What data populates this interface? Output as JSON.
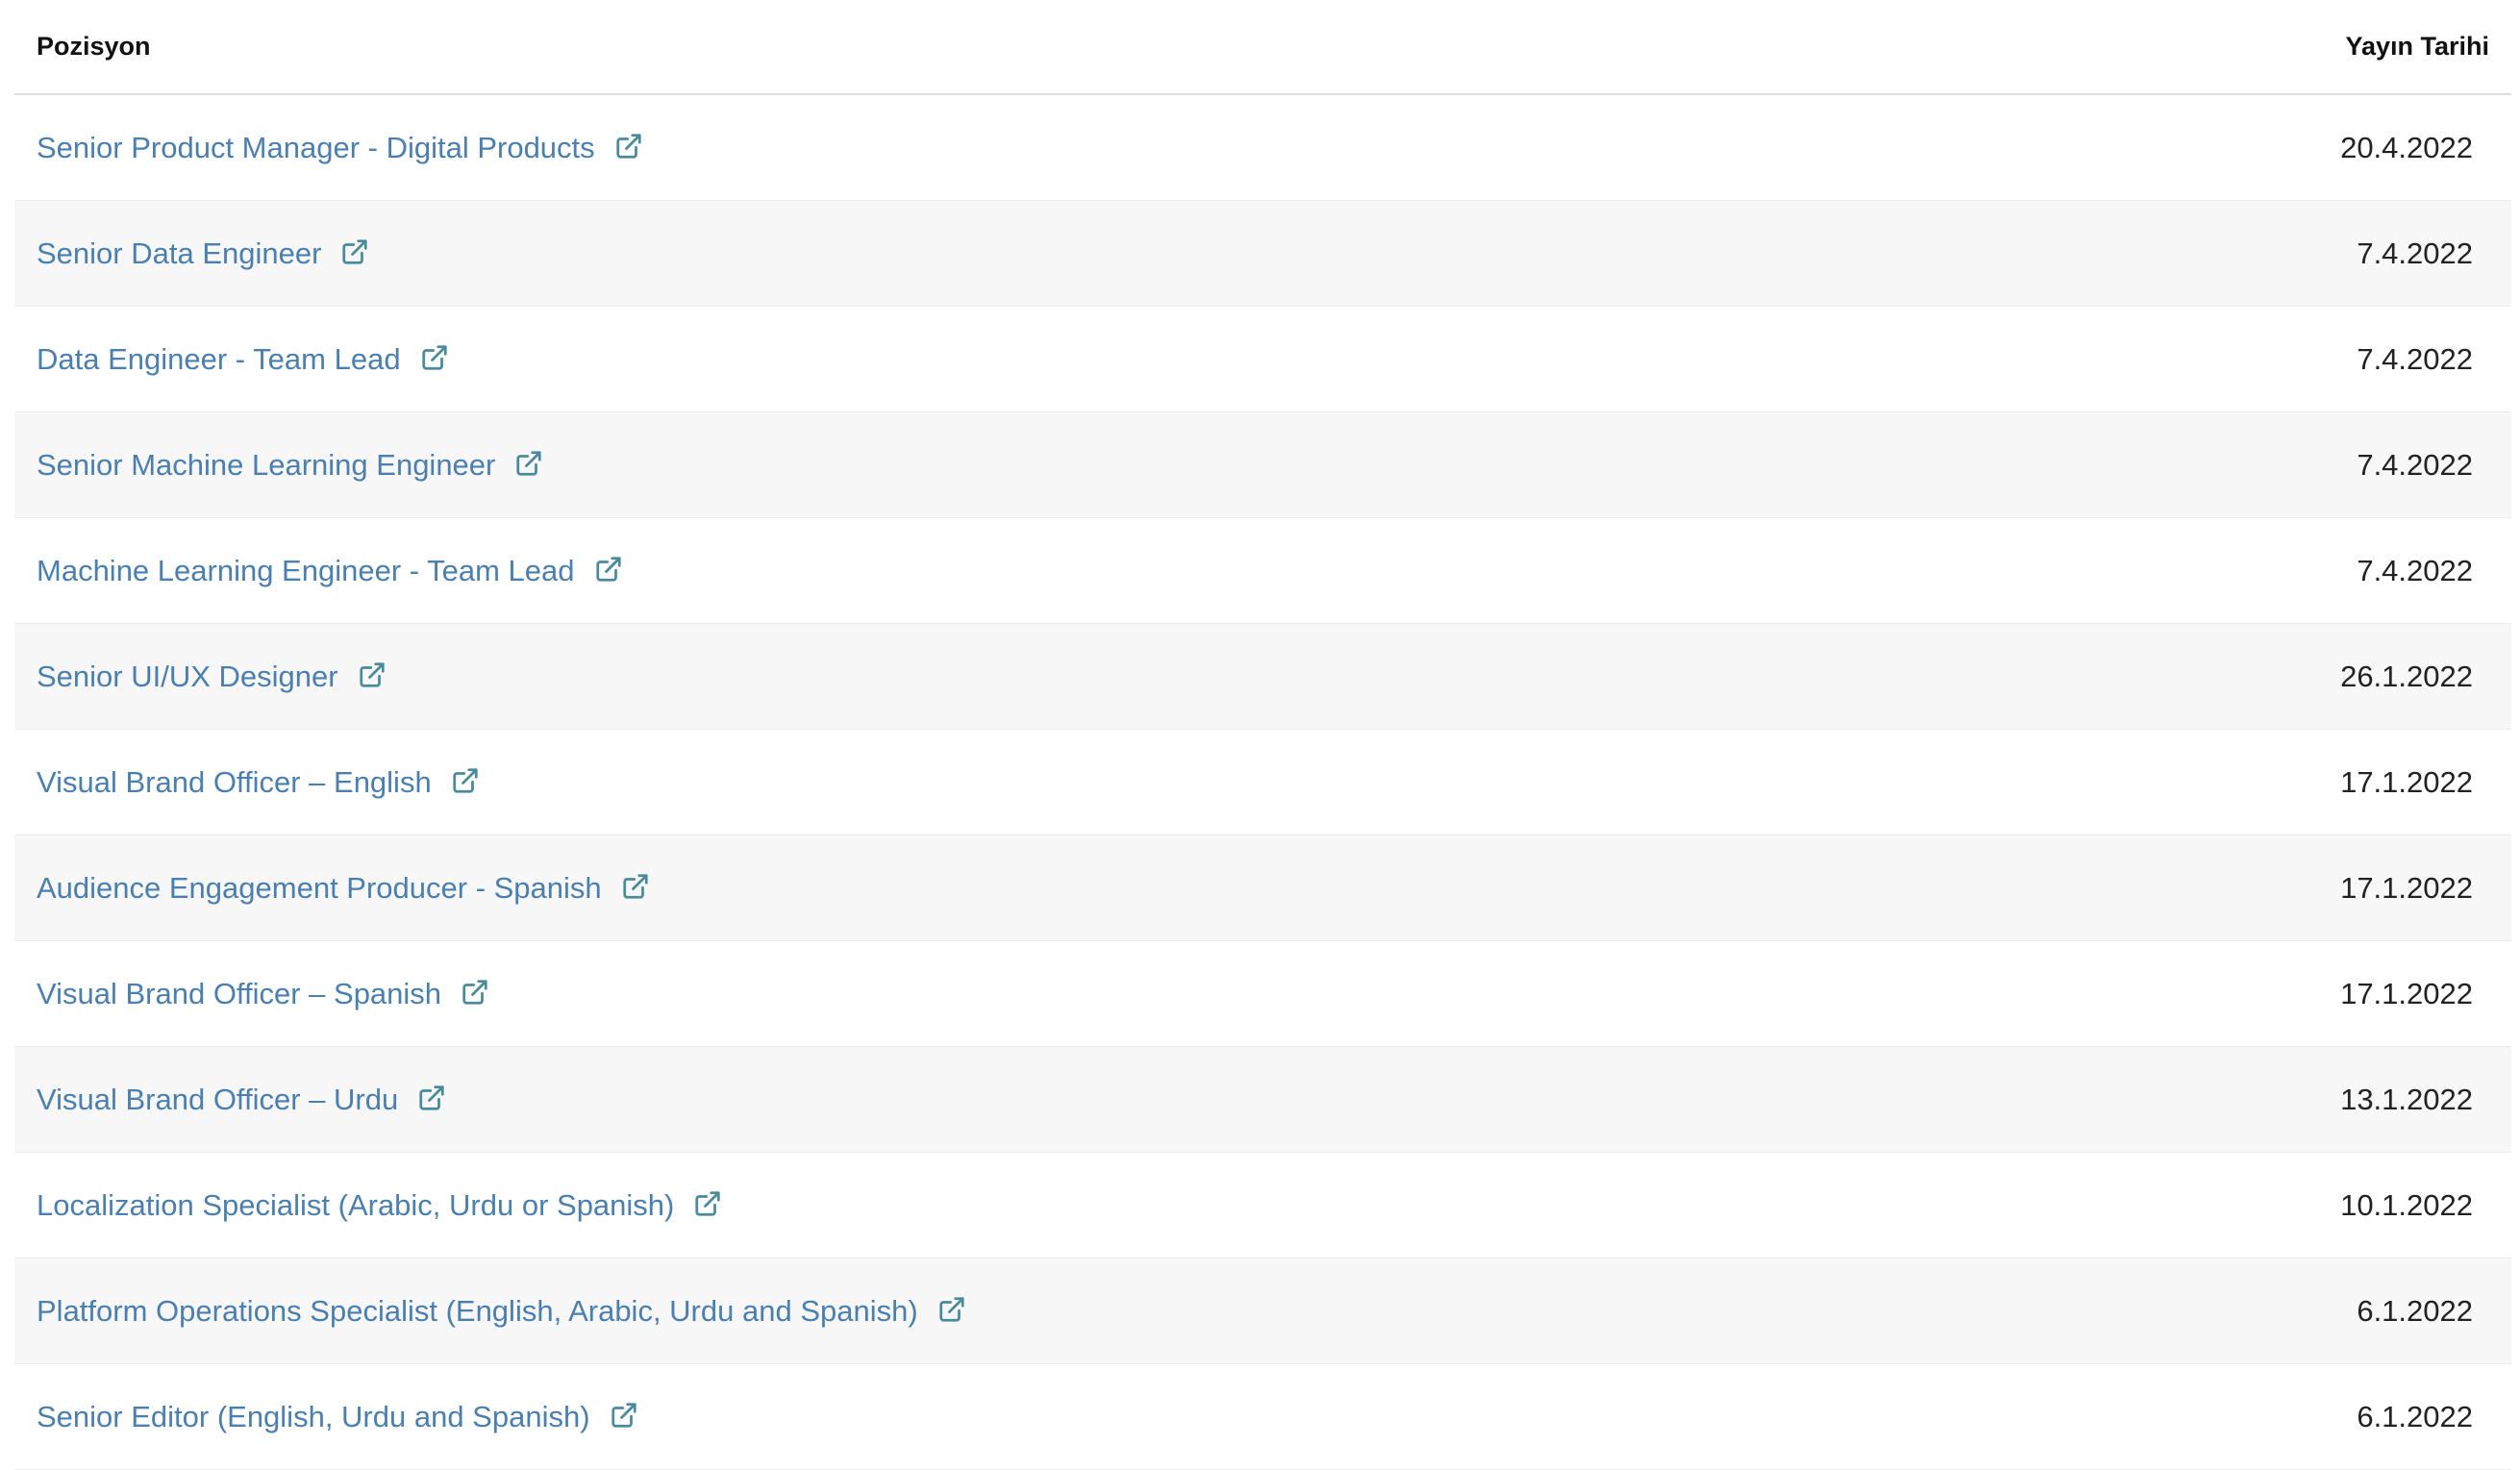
{
  "table": {
    "headers": {
      "position": "Pozisyon",
      "date": "Yayın Tarihi"
    },
    "rows": [
      {
        "title": "Senior Product Manager - Digital Products",
        "date": "20.4.2022"
      },
      {
        "title": "Senior Data Engineer",
        "date": "7.4.2022"
      },
      {
        "title": "Data Engineer - Team Lead",
        "date": "7.4.2022"
      },
      {
        "title": "Senior Machine Learning Engineer",
        "date": "7.4.2022"
      },
      {
        "title": "Machine Learning Engineer - Team Lead",
        "date": "7.4.2022"
      },
      {
        "title": "Senior UI/UX Designer",
        "date": "26.1.2022"
      },
      {
        "title": "Visual Brand Officer – English",
        "date": "17.1.2022"
      },
      {
        "title": "Audience Engagement Producer - Spanish",
        "date": "17.1.2022"
      },
      {
        "title": "Visual Brand Officer – Spanish",
        "date": "17.1.2022"
      },
      {
        "title": "Visual Brand Officer – Urdu",
        "date": "13.1.2022"
      },
      {
        "title": "Localization Specialist (Arabic, Urdu or Spanish)",
        "date": "10.1.2022"
      },
      {
        "title": "Platform Operations Specialist (English, Arabic, Urdu and Spanish)",
        "date": "6.1.2022"
      },
      {
        "title": "Senior Editor (English, Urdu and Spanish)",
        "date": "6.1.2022"
      }
    ]
  },
  "icons": {
    "row_link_icon": "external-link-icon"
  },
  "colors": {
    "link": "#4a7fb0",
    "icon": "#4a8a9a",
    "alt_row_bg": "#f7f7f7"
  }
}
